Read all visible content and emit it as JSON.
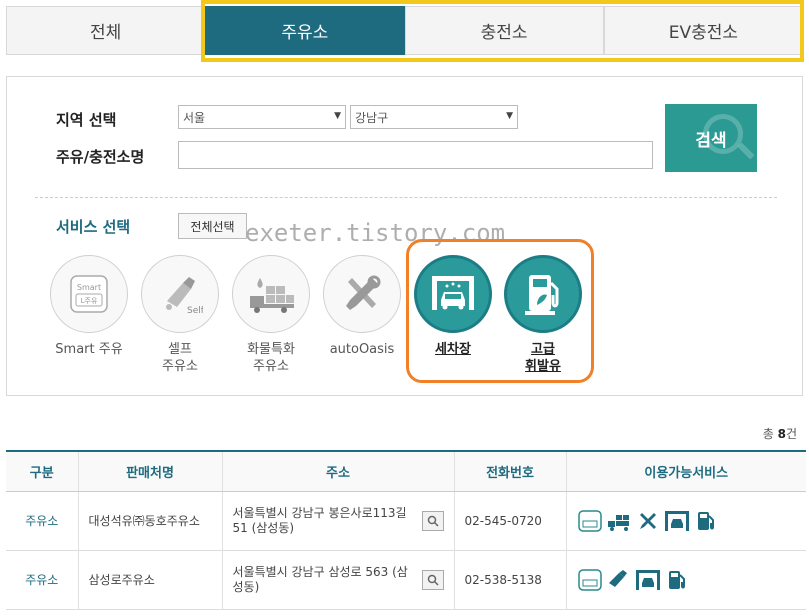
{
  "tabs": [
    {
      "label": "전체",
      "active": false
    },
    {
      "label": "주유소",
      "active": true
    },
    {
      "label": "충전소",
      "active": false
    },
    {
      "label": "EV충전소",
      "active": false
    }
  ],
  "search": {
    "region_label": "지역 선택",
    "city_value": "서울",
    "district_value": "강남구",
    "station_name_label": "주유/충전소명",
    "station_name_value": "",
    "search_button": "검색"
  },
  "services": {
    "title": "서비스 선택",
    "select_all": "전체선택",
    "items": [
      {
        "name": "Smart 주유",
        "name2": "",
        "selected": false,
        "icon": "smart-fuel-icon"
      },
      {
        "name": "셀프",
        "name2": "주유소",
        "selected": false,
        "icon": "self-fuel-icon"
      },
      {
        "name": "화물특화",
        "name2": "주유소",
        "selected": false,
        "icon": "truck-icon"
      },
      {
        "name": "autoOasis",
        "name2": "",
        "selected": false,
        "icon": "tools-icon"
      },
      {
        "name": "세차장",
        "name2": "",
        "selected": true,
        "icon": "car-wash-icon"
      },
      {
        "name": "고급",
        "name2": "휘발유",
        "selected": true,
        "icon": "premium-fuel-icon"
      }
    ]
  },
  "watermark": "exeter.tistory.com",
  "results": {
    "count_prefix": "총 ",
    "count": "8",
    "count_suffix": "건",
    "columns": [
      "구분",
      "판매처명",
      "주소",
      "전화번호",
      "이용가능서비스"
    ],
    "rows": [
      {
        "type": "주유소",
        "name": "대성석유㈜동호주유소",
        "address": "서울특별시 강남구 봉은사로113길 51 (삼성동)",
        "phone": "02-545-0720"
      },
      {
        "type": "주유소",
        "name": "삼성로주유소",
        "address": "서울특별시 강남구 삼성로 563 (삼성동)",
        "phone": "02-538-5138"
      }
    ]
  },
  "colors": {
    "accent": "#1e6b80",
    "search": "#2b9a93",
    "tab_highlight": "#f2c81a",
    "service_highlight": "#f08128"
  }
}
